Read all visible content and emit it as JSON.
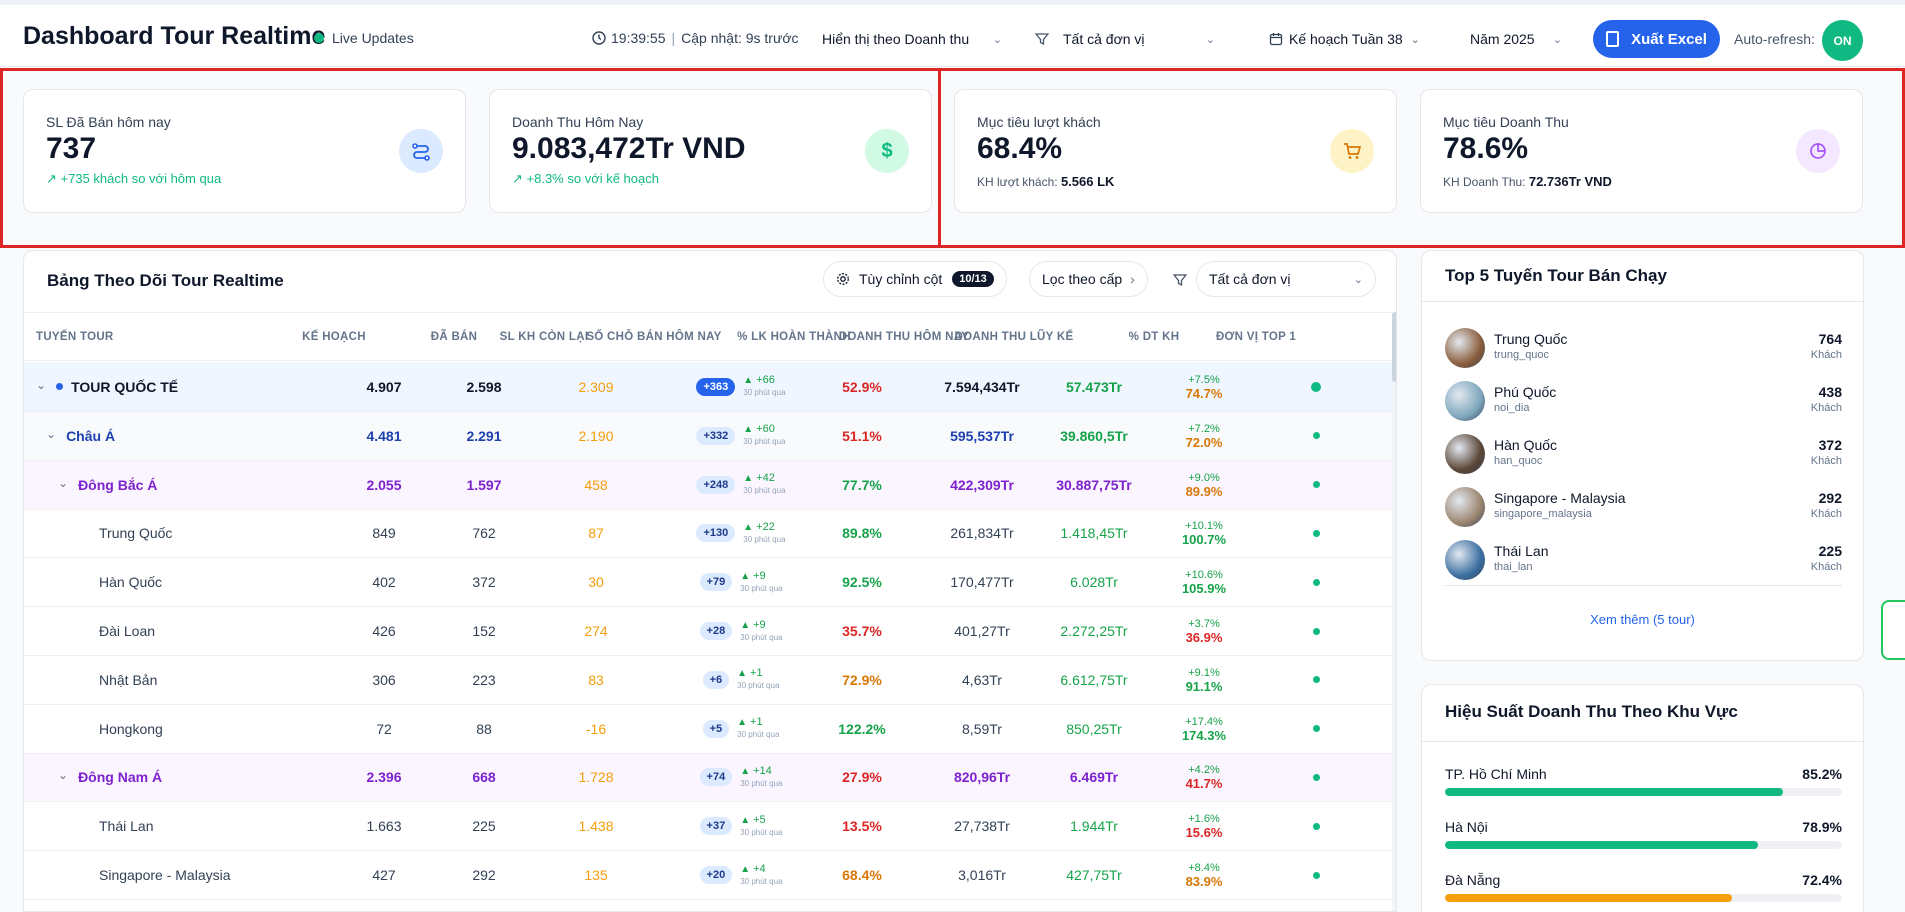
{
  "header": {
    "title": "Dashboard Tour Realtime",
    "live": "Live Updates",
    "time": "19:39:55",
    "updated": "Cập nhật: 9s trước",
    "display_select": "Hiển thị theo Doanh thu",
    "unit_filter": "Tất cả đơn vị",
    "plan_select": "Kế hoạch Tuần 38",
    "year_select": "Năm 2025",
    "export_label": "Xuất Excel",
    "auto_refresh_label": "Auto-refresh:",
    "auto_refresh_state": "ON"
  },
  "kpis": [
    {
      "label": "SL Đã Bán hôm nay",
      "value": "737",
      "trend": "+735 khách so với hôm qua",
      "icon": "route-icon",
      "icon_bg": "#dbeafe",
      "icon_color": "#2563eb"
    },
    {
      "label": "Doanh Thu Hôm Nay",
      "value": "9.083,472Tr VND",
      "trend": "+8.3% so với kế hoạch",
      "icon": "dollar-icon",
      "icon_bg": "#d1fae5",
      "icon_color": "#10b981"
    },
    {
      "label": "Mục tiêu lượt khách",
      "value": "68.4%",
      "sub_label": "KH lượt khách:",
      "sub_value": "5.566 LK",
      "icon": "cart-icon",
      "icon_bg": "#fef3c7",
      "icon_color": "#d97706"
    },
    {
      "label": "Mục tiêu Doanh Thu",
      "value": "78.6%",
      "sub_label": "KH Doanh Thu:",
      "sub_value": "72.736Tr VND",
      "icon": "pie-icon",
      "icon_bg": "#f3e8ff",
      "icon_color": "#a855f7"
    }
  ],
  "table": {
    "title": "Bảng Theo Dõi Tour Realtime",
    "customize_label": "Tùy chỉnh cột",
    "customize_count": "10/13",
    "filter_level_label": "Lọc theo cấp",
    "unit_filter": "Tất cả đơn vị",
    "headers": [
      "TUYẾN TOUR",
      "KẾ HOẠCH",
      "ĐÃ BÁN",
      "SL KH CÒN LẠI",
      "SỐ CHỖ BÁN HÔM NAY",
      "% LK HOÀN THÀNH",
      "DOANH THU HÔM NAY",
      "DOANH THU LŨY KẾ",
      "% DT KH",
      "ĐƠN VỊ TOP 1"
    ],
    "time_note": "30 phút qua",
    "rows": [
      {
        "level": 0,
        "name": "TOUR QUỐC TẾ",
        "plan": "4.907",
        "sold": "2.598",
        "remain": "2.309",
        "today": "+363",
        "inc": "+66",
        "pct": "52.9%",
        "rev_today": "7.594,434Tr",
        "rev_total": "57.473Tr",
        "dt_up": "+7.5%",
        "dt": "74.7%"
      },
      {
        "level": 1,
        "name": "Châu Á",
        "plan": "4.481",
        "sold": "2.291",
        "remain": "2.190",
        "today": "+332",
        "inc": "+60",
        "pct": "51.1%",
        "rev_today": "595,537Tr",
        "rev_total": "39.860,5Tr",
        "dt_up": "+7.2%",
        "dt": "72.0%"
      },
      {
        "level": 2,
        "name": "Đông Bắc Á",
        "plan": "2.055",
        "sold": "1.597",
        "remain": "458",
        "today": "+248",
        "inc": "+42",
        "pct": "77.7%",
        "rev_today": "422,309Tr",
        "rev_total": "30.887,75Tr",
        "dt_up": "+9.0%",
        "dt": "89.9%"
      },
      {
        "level": 3,
        "name": "Trung Quốc",
        "plan": "849",
        "sold": "762",
        "remain": "87",
        "today": "+130",
        "inc": "+22",
        "pct": "89.8%",
        "rev_today": "261,834Tr",
        "rev_total": "1.418,45Tr",
        "dt_up": "+10.1%",
        "dt": "100.7%"
      },
      {
        "level": 3,
        "name": "Hàn Quốc",
        "plan": "402",
        "sold": "372",
        "remain": "30",
        "today": "+79",
        "inc": "+9",
        "pct": "92.5%",
        "rev_today": "170,477Tr",
        "rev_total": "6.028Tr",
        "dt_up": "+10.6%",
        "dt": "105.9%"
      },
      {
        "level": 3,
        "name": "Đài Loan",
        "plan": "426",
        "sold": "152",
        "remain": "274",
        "today": "+28",
        "inc": "+9",
        "pct": "35.7%",
        "rev_today": "401,27Tr",
        "rev_total": "2.272,25Tr",
        "dt_up": "+3.7%",
        "dt": "36.9%"
      },
      {
        "level": 3,
        "name": "Nhật Bản",
        "plan": "306",
        "sold": "223",
        "remain": "83",
        "today": "+6",
        "inc": "+1",
        "pct": "72.9%",
        "rev_today": "4,63Tr",
        "rev_total": "6.612,75Tr",
        "dt_up": "+9.1%",
        "dt": "91.1%"
      },
      {
        "level": 3,
        "name": "Hongkong",
        "plan": "72",
        "sold": "88",
        "remain": "-16",
        "today": "+5",
        "inc": "+1",
        "pct": "122.2%",
        "rev_today": "8,59Tr",
        "rev_total": "850,25Tr",
        "dt_up": "+17.4%",
        "dt": "174.3%"
      },
      {
        "level": 2,
        "name": "Đông Nam Á",
        "plan": "2.396",
        "sold": "668",
        "remain": "1.728",
        "today": "+74",
        "inc": "+14",
        "pct": "27.9%",
        "rev_today": "820,96Tr",
        "rev_total": "6.469Tr",
        "dt_up": "+4.2%",
        "dt": "41.7%"
      },
      {
        "level": 3,
        "name": "Thái Lan",
        "plan": "1.663",
        "sold": "225",
        "remain": "1.438",
        "today": "+37",
        "inc": "+5",
        "pct": "13.5%",
        "rev_today": "27,738Tr",
        "rev_total": "1.944Tr",
        "dt_up": "+1.6%",
        "dt": "15.6%"
      },
      {
        "level": 3,
        "name": "Singapore - Malaysia",
        "plan": "427",
        "sold": "292",
        "remain": "135",
        "today": "+20",
        "inc": "+4",
        "pct": "68.4%",
        "rev_today": "3,016Tr",
        "rev_total": "427,75Tr",
        "dt_up": "+8.4%",
        "dt": "83.9%"
      }
    ]
  },
  "top_tours": {
    "title": "Top 5 Tuyến Tour Bán Chạy",
    "unit": "Khách",
    "more_link": "Xem thêm (5 tour)",
    "items": [
      {
        "name": "Trung Quốc",
        "slug": "trung_quoc",
        "count": "764",
        "color": "#8b5e3c"
      },
      {
        "name": "Phú Quốc",
        "slug": "noi_dia",
        "count": "438",
        "color": "#7fa7bd"
      },
      {
        "name": "Hàn Quốc",
        "slug": "han_quoc",
        "count": "372",
        "color": "#5b4636"
      },
      {
        "name": "Singapore - Malaysia",
        "slug": "singapore_malaysia",
        "count": "292",
        "color": "#9c8670"
      },
      {
        "name": "Thái Lan",
        "slug": "thai_lan",
        "count": "225",
        "color": "#3b6fa0"
      }
    ]
  },
  "regions": {
    "title": "Hiệu Suất Doanh Thu Theo Khu Vực",
    "items": [
      {
        "name": "TP. Hồ Chí Minh",
        "pct": "85.2%",
        "value": 0.852,
        "color": "#10b981"
      },
      {
        "name": "Hà Nội",
        "pct": "78.9%",
        "value": 0.789,
        "color": "#10b981"
      },
      {
        "name": "Đà Nẵng",
        "pct": "72.4%",
        "value": 0.724,
        "color": "#f59e0b"
      }
    ]
  }
}
